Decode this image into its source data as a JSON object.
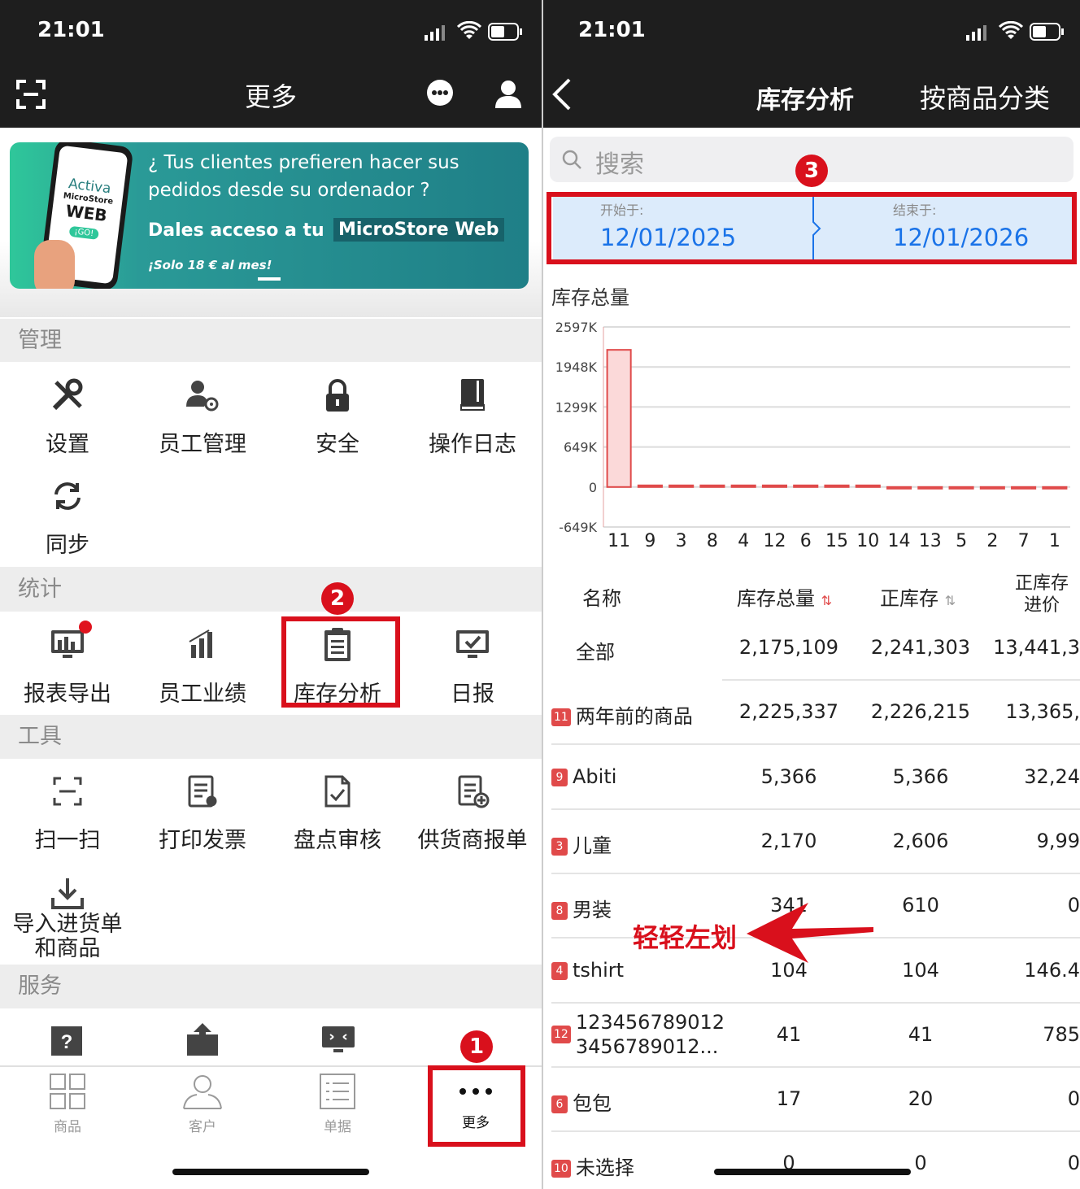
{
  "left": {
    "status_time": "21:01",
    "nav_title": "更多",
    "banner": {
      "phone_text_1": "Activa",
      "phone_text_2": "MicroStore",
      "phone_text_3": "WEB",
      "phone_text_4": "¡GO!",
      "line1": "¿ Tus clientes prefieren hacer sus",
      "line2": "pedidos desde su ordenador ?",
      "line3a": "Dales acceso a tu",
      "line3b": "MicroStore Web",
      "line4": "¡Solo 18 € al mes!"
    },
    "sections": {
      "manage": "管理",
      "stats": "统计",
      "tools": "工具",
      "service": "服务"
    },
    "manage_items": [
      "设置",
      "员工管理",
      "安全",
      "操作日志",
      "同步"
    ],
    "stats_items": [
      "报表导出",
      "员工业绩",
      "库存分析",
      "日报"
    ],
    "tools_items": [
      "扫一扫",
      "打印发票",
      "盘点审核",
      "供货商报单"
    ],
    "import_item_line1": "导入进货单",
    "import_item_line2": "和商品",
    "tabs": [
      "商品",
      "客户",
      "单据",
      "更多"
    ],
    "markers": [
      "1",
      "2"
    ]
  },
  "right": {
    "status_time": "21:01",
    "nav_title": "库存分析",
    "nav_action": "按商品分类",
    "search_placeholder": "搜索",
    "marker": "3",
    "start_label": "开始于:",
    "start_date": "12/01/2025",
    "end_label": "结束于:",
    "end_date": "12/01/2026",
    "chart_title": "库存总量",
    "swipe_hint": "轻轻左划",
    "table_headers": [
      "名称",
      "库存总量",
      "正库存",
      "正库存\n进价"
    ],
    "table_header_col4_line1": "正库存",
    "table_header_col4_line2": "进价",
    "rows": [
      {
        "tag": "",
        "name": "全部",
        "total": "2,175,109",
        "positive": "2,241,303",
        "cost": "13,441,3"
      },
      {
        "tag": "11",
        "name": "两年前的商品",
        "total": "2,225,337",
        "positive": "2,226,215",
        "cost": "13,365,"
      },
      {
        "tag": "9",
        "name": "Abiti",
        "total": "5,366",
        "positive": "5,366",
        "cost": "32,24"
      },
      {
        "tag": "3",
        "name": "儿童",
        "total": "2,170",
        "positive": "2,606",
        "cost": "9,99"
      },
      {
        "tag": "8",
        "name": "男装",
        "total": "341",
        "positive": "610",
        "cost": "0"
      },
      {
        "tag": "4",
        "name": "tshirt",
        "total": "104",
        "positive": "104",
        "cost": "146.4"
      },
      {
        "tag": "12",
        "name": "123456789012\n3456789012...",
        "name_line1": "123456789012",
        "name_line2": "3456789012...",
        "total": "41",
        "positive": "41",
        "cost": "785"
      },
      {
        "tag": "6",
        "name": "包包",
        "total": "17",
        "positive": "20",
        "cost": "0"
      },
      {
        "tag": "10",
        "name": "未选择",
        "total": "0",
        "positive": "0",
        "cost": "0"
      }
    ]
  },
  "chart_data": {
    "type": "bar",
    "title": "库存总量",
    "categories": [
      "11",
      "9",
      "3",
      "8",
      "4",
      "12",
      "6",
      "15",
      "10",
      "14",
      "13",
      "5",
      "2",
      "7",
      "1"
    ],
    "values": [
      2225337,
      5366,
      2170,
      341,
      104,
      41,
      17,
      0,
      0,
      -2000,
      -2500,
      -3000,
      -3500,
      -5000,
      -8000
    ],
    "y_tick_labels": [
      "2597K",
      "1948K",
      "1299K",
      "649K",
      "0",
      "-649K"
    ],
    "ylim": [
      -649000,
      2597000
    ],
    "grid": true,
    "bar_color": "#e04a4a"
  },
  "colors": {
    "accent_red": "#d9101c",
    "topbar": "#1e1e1e",
    "date_blue": "#1a73e8",
    "banner_teal": "#2a8f8f"
  }
}
